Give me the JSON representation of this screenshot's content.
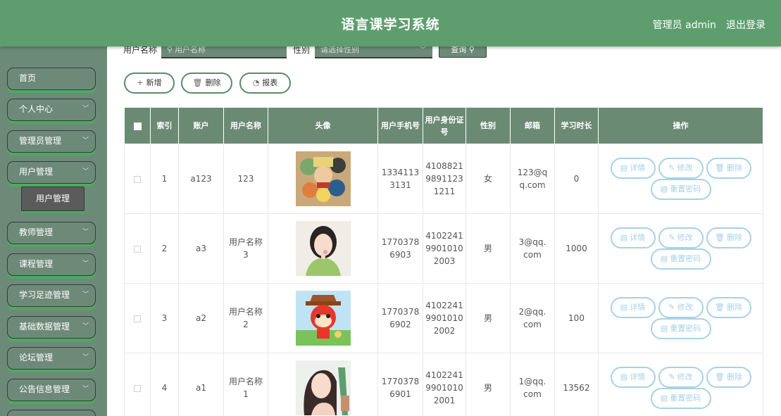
{
  "header": {
    "title": "语言课学习系统",
    "user_label": "管理员 admin",
    "logout_label": "退出登录"
  },
  "sidebar": {
    "items": [
      {
        "label": "首页",
        "has_chevron": false
      },
      {
        "label": "个人中心",
        "has_chevron": true
      },
      {
        "label": "管理员管理",
        "has_chevron": true
      },
      {
        "label": "用户管理",
        "has_chevron": true
      },
      {
        "label": "教师管理",
        "has_chevron": true
      },
      {
        "label": "课程管理",
        "has_chevron": true
      },
      {
        "label": "学习足迹管理",
        "has_chevron": true
      },
      {
        "label": "基础数据管理",
        "has_chevron": true
      },
      {
        "label": "论坛管理",
        "has_chevron": true
      },
      {
        "label": "公告信息管理",
        "has_chevron": true
      }
    ],
    "active_sub": "用户管理"
  },
  "search": {
    "username_label": "用户名称",
    "username_placeholder": "用户名称",
    "gender_label": "性别",
    "gender_placeholder": "请选择性别",
    "query_label": "查询"
  },
  "actions": {
    "add_label": "新增",
    "delete_label": "删除",
    "report_label": "报表"
  },
  "table": {
    "headers": {
      "index": "索引",
      "account": "账户",
      "username": "用户名称",
      "avatar": "头像",
      "phone": "用户手机号",
      "idcard": "用户身份证号",
      "gender": "性别",
      "email": "邮箱",
      "duration": "学习时长",
      "ops": "操作"
    },
    "op_labels": {
      "detail": "详情",
      "edit": "修改",
      "delete": "删除",
      "reset": "重置密码"
    },
    "rows": [
      {
        "index": "1",
        "account": "a123",
        "username": "123",
        "phone": "13341133131",
        "idcard": "410882198911231211",
        "gender": "女",
        "email": "123@qq.com",
        "duration": "0",
        "avatar": "cartoon-pirates-icon"
      },
      {
        "index": "2",
        "account": "a3",
        "username": "用户名称3",
        "phone": "17703786903",
        "idcard": "410224199010102003",
        "gender": "男",
        "email": "3@qq.com",
        "duration": "1000",
        "avatar": "girl-photo-icon"
      },
      {
        "index": "3",
        "account": "a2",
        "username": "用户名称2",
        "phone": "17703786902",
        "idcard": "410224199010102002",
        "gender": "男",
        "email": "2@qq.com",
        "duration": "100",
        "avatar": "cartoon-fox-icon"
      },
      {
        "index": "4",
        "account": "a1",
        "username": "用户名称1",
        "phone": "17703786901",
        "idcard": "410224199010102001",
        "gender": "男",
        "email": "1@qq.com",
        "duration": "13562",
        "avatar": "illustrated-woman-icon"
      }
    ]
  },
  "colors": {
    "header": "#5e9e6e",
    "sidebar": "#6d8a78",
    "table_header": "#6b8a74",
    "op_border": "#a7d2e6"
  }
}
